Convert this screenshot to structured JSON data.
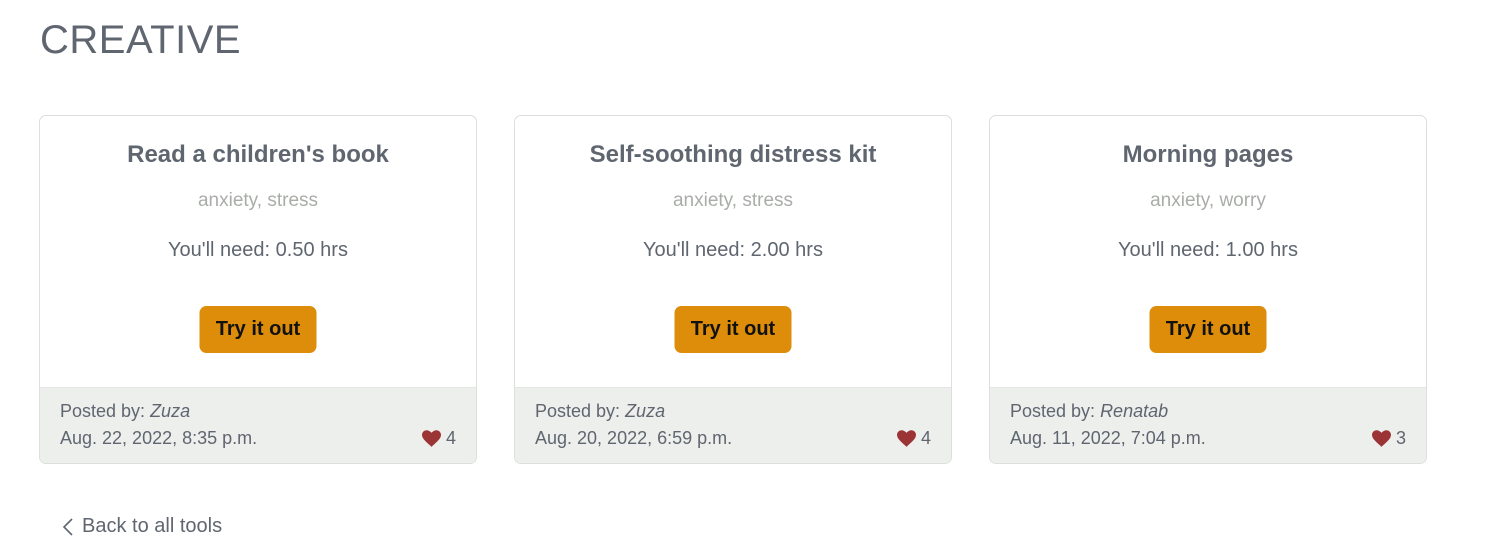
{
  "page": {
    "category_title": "CREATIVE"
  },
  "colors": {
    "accent": "#dd8d09",
    "heart": "#9b3434",
    "footer_bg": "#edefec",
    "tag_text": "#a9ada8"
  },
  "cards": [
    {
      "title": "Read a children's book",
      "tags": "anxiety, stress",
      "duration_prefix": "You'll need: ",
      "duration": "0.50 hrs",
      "button_label": "Try it out",
      "posted_by_label": "Posted by: ",
      "author": "Zuza",
      "date": "Aug. 22, 2022, 8:35 p.m.",
      "likes": "4",
      "like_icon": "heart-icon"
    },
    {
      "title": "Self-soothing distress kit",
      "tags": "anxiety, stress",
      "duration_prefix": "You'll need: ",
      "duration": "2.00 hrs",
      "button_label": "Try it out",
      "posted_by_label": "Posted by: ",
      "author": "Zuza",
      "date": "Aug. 20, 2022, 6:59 p.m.",
      "likes": "4",
      "like_icon": "heart-icon"
    },
    {
      "title": "Morning pages",
      "tags": "anxiety, worry",
      "duration_prefix": "You'll need: ",
      "duration": "1.00 hrs",
      "button_label": "Try it out",
      "posted_by_label": "Posted by: ",
      "author": "Renatab",
      "date": "Aug. 11, 2022, 7:04 p.m.",
      "likes": "3",
      "like_icon": "heart-icon"
    }
  ],
  "back_link": {
    "label": "Back to all tools",
    "icon": "chevron-left-icon"
  }
}
